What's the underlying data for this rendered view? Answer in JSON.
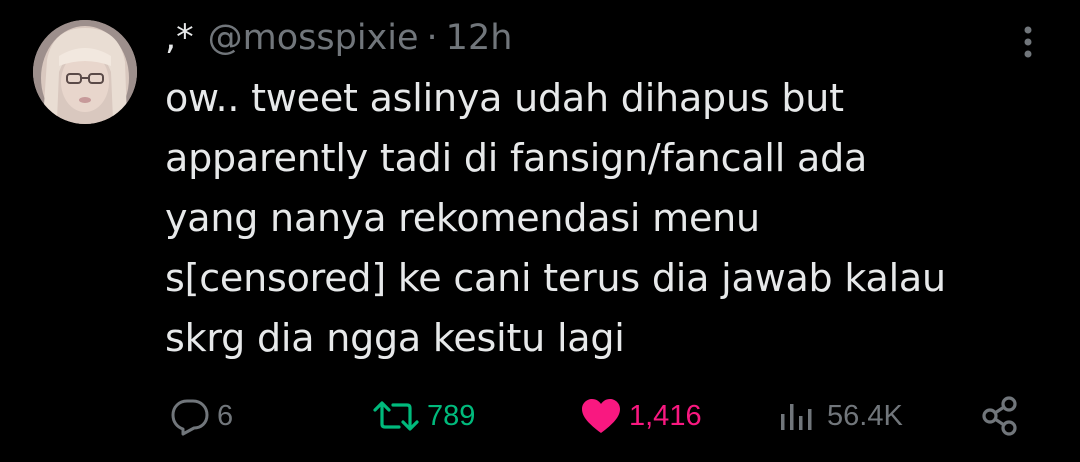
{
  "tweet": {
    "display_name": ",*",
    "handle": "@mosspixie",
    "separator": "·",
    "time": "12h",
    "text": "ow.. tweet aslinya udah dihapus but\napparently tadi di fansign/fancall ada\nyang nanya rekomendasi menu\ns[censored] ke cani terus dia jawab kalau\nskrg dia ngga kesitu lagi"
  },
  "actions": {
    "reply": {
      "icon": "reply-icon",
      "count": "6"
    },
    "retweet": {
      "icon": "retweet-icon",
      "count": "789",
      "color": "#00ba7c"
    },
    "like": {
      "icon": "heart-filled-icon",
      "count": "1,416",
      "color": "#f91880"
    },
    "views": {
      "icon": "views-bar-chart-icon",
      "count": "56.4K"
    },
    "share": {
      "icon": "share-icon"
    }
  },
  "more_menu": {
    "icon": "more-vertical-icon"
  },
  "colors": {
    "background": "#000000",
    "text": "#e7e9ea",
    "secondary": "#71767b"
  }
}
